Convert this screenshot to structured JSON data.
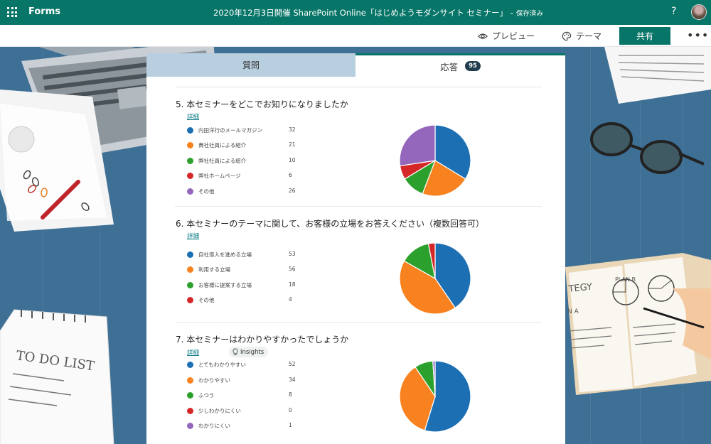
{
  "topbar": {
    "app_name": "Forms",
    "document_title": "2020年12月3日開催 SharePoint Online「はじめようモダンサイト セミナー」 -",
    "save_status": "保存済み",
    "help_label": "?"
  },
  "commandbar": {
    "preview_label": "プレビュー",
    "theme_label": "テーマ",
    "share_label": "共有",
    "more_label": "•••"
  },
  "tabs": {
    "questions_label": "質問",
    "responses_label": "応答",
    "response_count": "95"
  },
  "questions": [
    {
      "title": "5. 本セミナーをどこでお知りになりましたか",
      "detail_label": "詳細",
      "options": [
        {
          "label": "内田洋行のメールマガジン",
          "count": 32,
          "color": "#1d6fb4"
        },
        {
          "label": "貴社社員による紹介",
          "count": 21,
          "color": "#f7821f"
        },
        {
          "label": "弊社社員による紹介",
          "count": 10,
          "color": "#2ca02c"
        },
        {
          "label": "弊社ホームページ",
          "count": 6,
          "color": "#d62728"
        },
        {
          "label": "その他",
          "count": 26,
          "color": "#9467bd"
        }
      ]
    },
    {
      "title": "6. 本セミナーのテーマに関して、お客様の立場をお答えください（複数回答可）",
      "detail_label": "詳細",
      "options": [
        {
          "label": "自社導入を進める立場",
          "count": 53,
          "color": "#1d6fb4"
        },
        {
          "label": "利用する立場",
          "count": 56,
          "color": "#f7821f"
        },
        {
          "label": "お客様に提案する立場",
          "count": 18,
          "color": "#2ca02c"
        },
        {
          "label": "その他",
          "count": 4,
          "color": "#d62728"
        }
      ]
    },
    {
      "title": "7. 本セミナーはわかりやすかったでしょうか",
      "detail_label": "詳細",
      "insights_label": "Insights",
      "options": [
        {
          "label": "とてもわかりやすい",
          "count": 52,
          "color": "#1d6fb4"
        },
        {
          "label": "わかりやすい",
          "count": 34,
          "color": "#f7821f"
        },
        {
          "label": "ふつう",
          "count": 8,
          "color": "#2ca02c"
        },
        {
          "label": "少しわかりにくい",
          "count": 0,
          "color": "#d62728"
        },
        {
          "label": "わかりにくい",
          "count": 1,
          "color": "#9467bd"
        }
      ]
    }
  ],
  "background": {
    "todo_label": "TO DO LIST",
    "notebook_label_1": "TEGY",
    "notebook_label_2": "PLAN B",
    "notebook_label_3": "N A"
  }
}
